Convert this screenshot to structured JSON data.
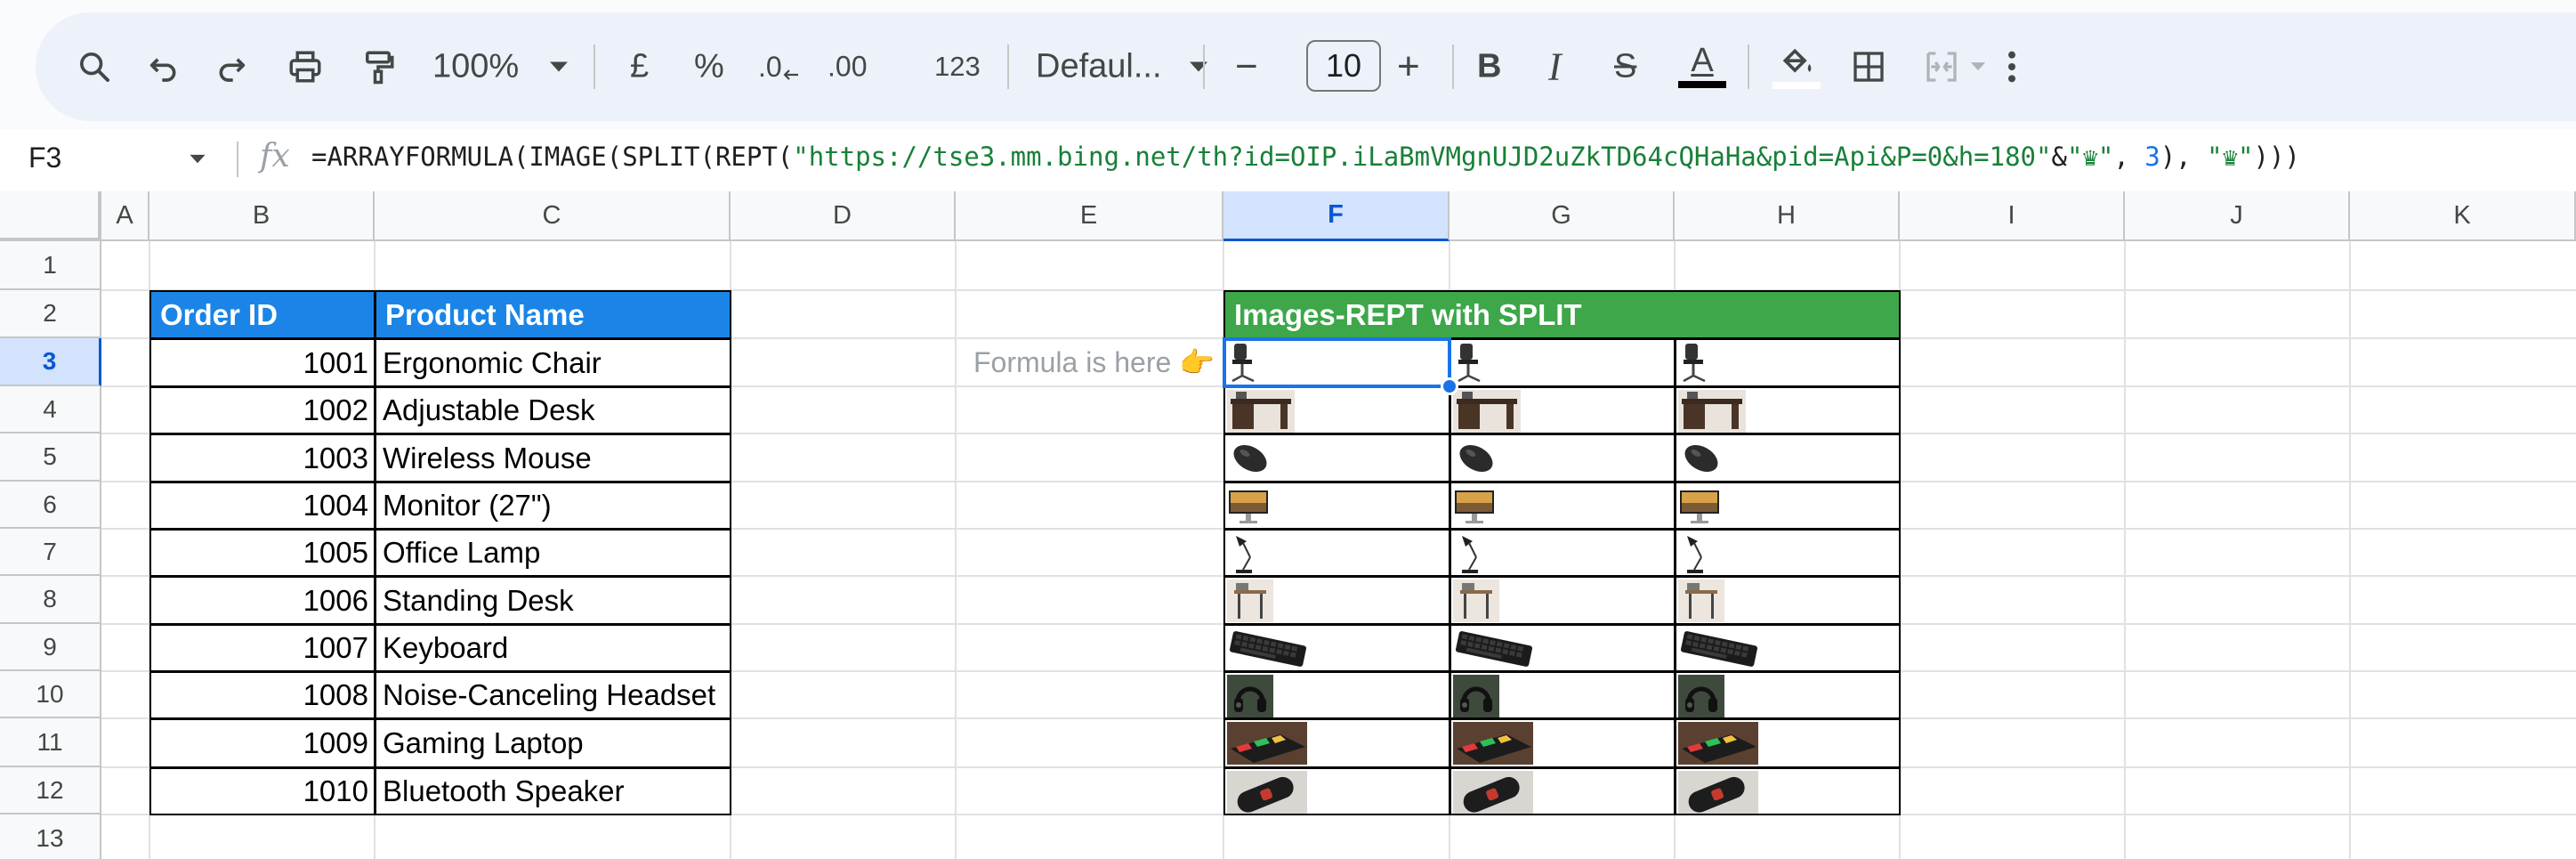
{
  "toolbar": {
    "zoom": "100%",
    "currency": "£",
    "percent": "%",
    "decrease_decimals": ".0",
    "increase_decimals": ".00",
    "number_format": "123",
    "font_family": "Defaul...",
    "font_size": "10",
    "minus": "−",
    "plus": "+",
    "bold": "B",
    "italic": "I",
    "strikethrough": "S",
    "text_color_letter": "A",
    "text_color": "#000000"
  },
  "formula_bar": {
    "cell_ref": "F3",
    "fx": "fx",
    "formula_prefix": "=ARRAYFORMULA(IMAGE(SPLIT(REPT(",
    "formula_url": "\"https://tse3.mm.bing.net/th?id=OIP.iLaBmVMgnUJD2uZkTD64cQHaHa&pid=Api&P=0&h=180\"",
    "formula_amp": "&",
    "formula_delim1": "\"♛\"",
    "formula_sep": ", ",
    "formula_count": "3",
    "formula_mid": "), ",
    "formula_delim2": "\"♛\"",
    "formula_suffix": ")))"
  },
  "columns": [
    "A",
    "B",
    "C",
    "D",
    "E",
    "F",
    "G",
    "H",
    "I",
    "J",
    "K"
  ],
  "selected_column": "F",
  "rows": [
    "1",
    "2",
    "3",
    "4",
    "5",
    "6",
    "7",
    "8",
    "9",
    "10",
    "11",
    "12",
    "13"
  ],
  "selected_row": "3",
  "table": {
    "headers": [
      "Order ID",
      "Product Name"
    ],
    "rows": [
      {
        "id": "1001",
        "name": "Ergonomic Chair"
      },
      {
        "id": "1002",
        "name": "Adjustable Desk"
      },
      {
        "id": "1003",
        "name": "Wireless Mouse"
      },
      {
        "id": "1004",
        "name": "Monitor (27\")"
      },
      {
        "id": "1005",
        "name": "Office Lamp"
      },
      {
        "id": "1006",
        "name": "Standing Desk"
      },
      {
        "id": "1007",
        "name": "Keyboard"
      },
      {
        "id": "1008",
        "name": "Noise-Canceling Headset"
      },
      {
        "id": "1009",
        "name": "Gaming Laptop"
      },
      {
        "id": "1010",
        "name": "Bluetooth Speaker"
      }
    ]
  },
  "note": "Formula is here 👉",
  "images_header": "Images-REPT with SPLIT",
  "image_items": [
    "chair",
    "desk",
    "mouse",
    "monitor",
    "lamp",
    "standing-desk",
    "keyboard",
    "headset",
    "laptop",
    "speaker"
  ],
  "colors": {
    "header_blue": "#1a85e6",
    "header_green": "#3da74a",
    "selection": "#1a73e8",
    "string_literal": "#188038"
  }
}
